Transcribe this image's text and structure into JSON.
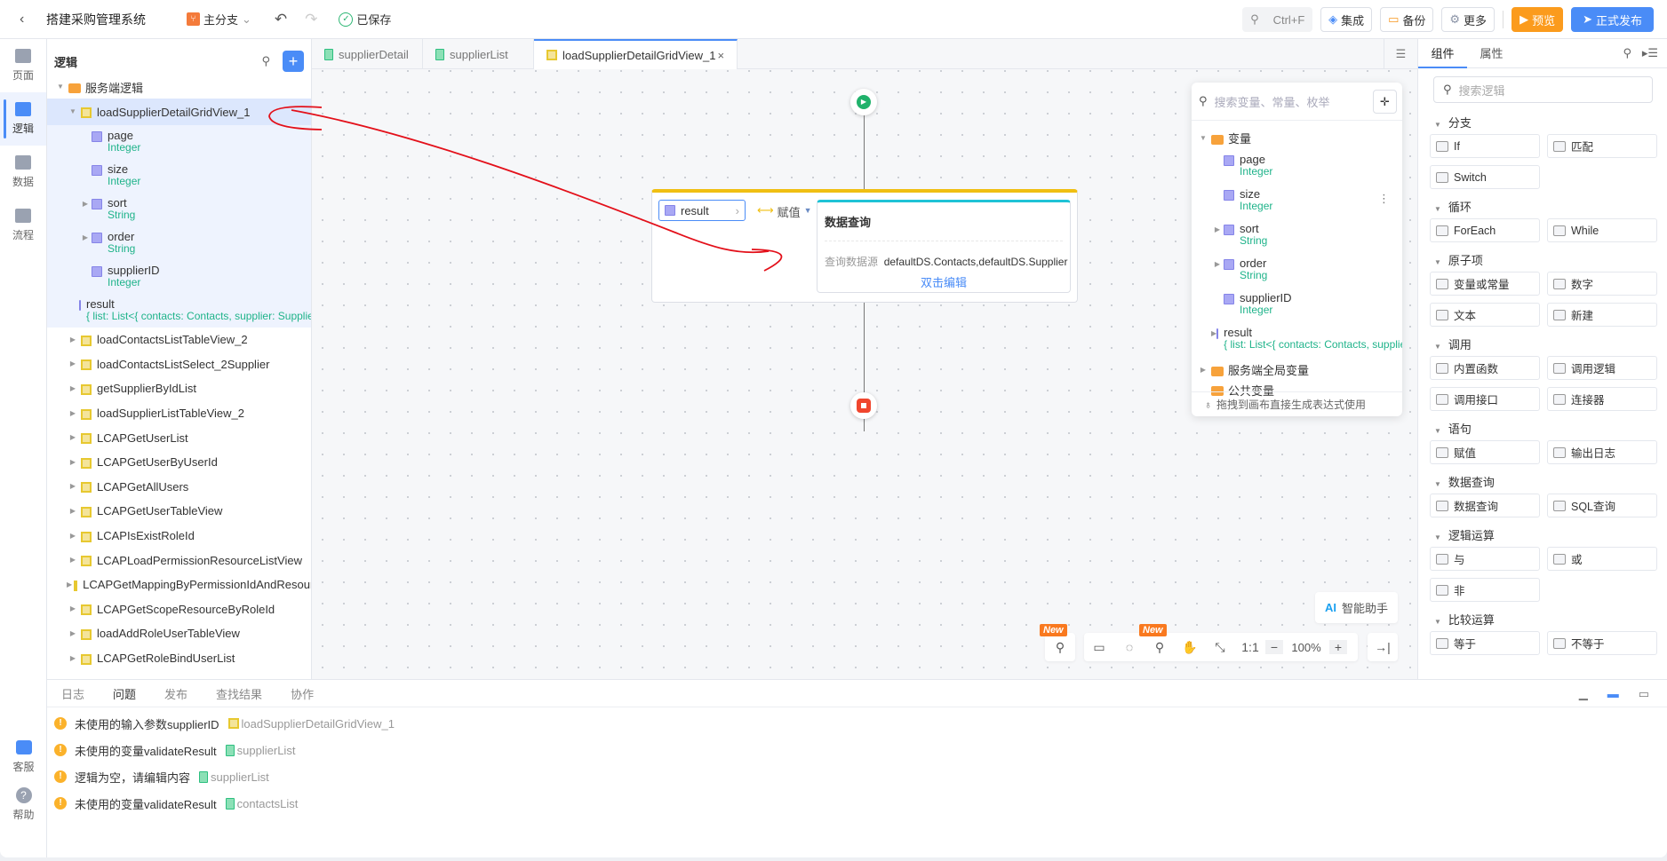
{
  "header": {
    "title": "搭建采购管理系统",
    "branch": "主分支",
    "saved": "已保存",
    "search_shortcut": "Ctrl+F",
    "integrate": "集成",
    "backup": "备份",
    "more": "更多",
    "preview": "预览",
    "publish": "正式发布"
  },
  "nav": {
    "items": [
      {
        "label": "页面"
      },
      {
        "label": "逻辑",
        "active": true
      },
      {
        "label": "数据"
      },
      {
        "label": "流程"
      }
    ],
    "service": "客服",
    "help": "帮助"
  },
  "tree": {
    "title": "逻辑",
    "folder": "服务端逻辑",
    "selected": "loadSupplierDetailGridView_1",
    "params": [
      {
        "name": "page",
        "type": "Integer",
        "expandable": false
      },
      {
        "name": "size",
        "type": "Integer",
        "expandable": false
      },
      {
        "name": "sort",
        "type": "String",
        "expandable": true
      },
      {
        "name": "order",
        "type": "String",
        "expandable": true
      },
      {
        "name": "supplierID",
        "type": "Integer",
        "expandable": false
      },
      {
        "name": "result",
        "type": "{ list: List<{ contacts: Contacts, supplier: Supplier }>, total: Long }",
        "expandable": false,
        "output": true
      }
    ],
    "items": [
      "loadContactsListTableView_2",
      "loadContactsListSelect_2Supplier",
      "getSupplierByIdList",
      "loadSupplierListTableView_2",
      "LCAPGetUserList",
      "LCAPGetUserByUserId",
      "LCAPGetAllUsers",
      "LCAPGetUserTableView",
      "LCAPIsExistRoleId",
      "LCAPLoadPermissionResourceListView",
      "LCAPGetMappingByPermissionIdAndResourceId",
      "LCAPGetScopeResourceByRoleId",
      "loadAddRoleUserTableView",
      "LCAPGetRoleBindUserList"
    ]
  },
  "tabs": [
    {
      "label": "supplierDetail",
      "kind": "page"
    },
    {
      "label": "supplierList",
      "kind": "page"
    },
    {
      "label": "loadSupplierDetailGridView_1",
      "kind": "logic",
      "active": true,
      "close": "×"
    }
  ],
  "canvas": {
    "assign_target": "result",
    "assign_label": "赋值",
    "query_title": "数据查询",
    "query_source_label": "查询数据源",
    "query_source": "defaultDS.Contacts,defaultDS.Supplier",
    "edit_hint": "双击编辑"
  },
  "var_panel": {
    "placeholder": "搜索变量、常量、枚举",
    "folder": "变量",
    "vars": [
      {
        "name": "page",
        "type": "Integer",
        "expandable": false
      },
      {
        "name": "size",
        "type": "Integer",
        "expandable": false
      },
      {
        "name": "sort",
        "type": "String",
        "expandable": true
      },
      {
        "name": "order",
        "type": "String",
        "expandable": true
      },
      {
        "name": "supplierID",
        "type": "Integer",
        "expandable": false
      },
      {
        "name": "result",
        "type": "{ list: List<{ contacts: Contacts, supplier: Supplier }> }",
        "expandable": true,
        "output": true
      }
    ],
    "global_folder": "服务端全局变量",
    "public_folder": "公共变量",
    "hint": "拖拽到画布直接生成表达式使用"
  },
  "toolbar": {
    "new_badge": "New",
    "ratio": "1:1",
    "zoom": "100%",
    "minus": "−",
    "plus": "+",
    "ai": "AI",
    "ai_label": "智能助手"
  },
  "right": {
    "tabs": [
      "组件",
      "属性"
    ],
    "placeholder": "搜索逻辑",
    "sections": [
      {
        "title": "分支",
        "items": [
          "If",
          "匹配",
          "Switch"
        ]
      },
      {
        "title": "循环",
        "items": [
          "ForEach",
          "While"
        ]
      },
      {
        "title": "原子项",
        "items": [
          "变量或常量",
          "数字",
          "文本",
          "新建"
        ]
      },
      {
        "title": "调用",
        "items": [
          "内置函数",
          "调用逻辑",
          "调用接口",
          "连接器"
        ]
      },
      {
        "title": "语句",
        "items": [
          "赋值",
          "输出日志"
        ]
      },
      {
        "title": "数据查询",
        "items": [
          "数据查询",
          "SQL查询"
        ]
      },
      {
        "title": "逻辑运算",
        "items": [
          "与",
          "或",
          "非"
        ]
      },
      {
        "title": "比较运算",
        "items": [
          "等于",
          "不等于"
        ]
      }
    ]
  },
  "bottom": {
    "tabs": [
      {
        "label": "日志"
      },
      {
        "label": "问题",
        "active": true
      },
      {
        "label": "发布"
      },
      {
        "label": "查找结果"
      },
      {
        "label": "协作"
      }
    ],
    "issues": [
      {
        "text": "未使用的输入参数supplierID",
        "link": "loadSupplierDetailGridView_1",
        "kind": "logic"
      },
      {
        "text": "未使用的变量validateResult",
        "link": "supplierList",
        "kind": "page"
      },
      {
        "text": "逻辑为空，请编辑内容",
        "link": "supplierList",
        "kind": "page"
      },
      {
        "text": "未使用的变量validateResult",
        "link": "contactsList",
        "kind": "page"
      }
    ]
  },
  "colors": {
    "accent": "#4a8cf7",
    "preview": "#fb9b1d",
    "type_text": "#1fb38a",
    "warning": "#fbb22b",
    "logic_block": "#f0bf12",
    "query_block": "#1fc3d6",
    "start": "#20b26b",
    "end": "#f0462e"
  }
}
